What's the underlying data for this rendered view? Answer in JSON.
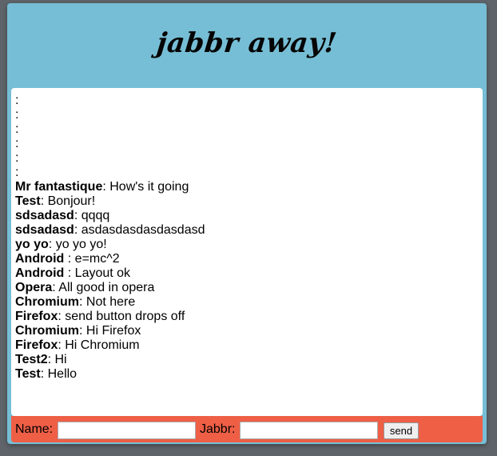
{
  "header": {
    "title": "jabbr away!"
  },
  "chat": {
    "placeholder_lines": [
      ":",
      ":",
      ":",
      ":",
      ":",
      ":"
    ],
    "messages": [
      {
        "user": "Mr fantastique",
        "sep": ": ",
        "text": "How's it going"
      },
      {
        "user": "Test",
        "sep": ": ",
        "text": "Bonjour!"
      },
      {
        "user": "sdsadasd",
        "sep": ": ",
        "text": "qqqq"
      },
      {
        "user": "sdsadasd",
        "sep": ": ",
        "text": "asdasdasdasdasdasd"
      },
      {
        "user": "yo yo",
        "sep": ": ",
        "text": "yo yo yo!"
      },
      {
        "user": "Android",
        "sep": " : ",
        "text": "e=mc^2"
      },
      {
        "user": "Android",
        "sep": " : ",
        "text": "Layout ok"
      },
      {
        "user": "Opera",
        "sep": ": ",
        "text": "All good in opera"
      },
      {
        "user": "Chromium",
        "sep": ": ",
        "text": "Not here"
      },
      {
        "user": "Firefox",
        "sep": ": ",
        "text": "send button drops off"
      },
      {
        "user": "Chromium",
        "sep": ": ",
        "text": "Hi Firefox"
      },
      {
        "user": "Firefox",
        "sep": ": ",
        "text": "Hi Chromium"
      },
      {
        "user": "Test2",
        "sep": ": ",
        "text": "Hi"
      },
      {
        "user": "Test",
        "sep": ": ",
        "text": "Hello"
      }
    ]
  },
  "form": {
    "name_label": "Name:",
    "name_value": "",
    "jabbr_label": "Jabbr:",
    "jabbr_value": "",
    "send_label": "send"
  },
  "colors": {
    "background": "#5e6469",
    "header": "#76bed5",
    "form_bar": "#ee5f46"
  }
}
